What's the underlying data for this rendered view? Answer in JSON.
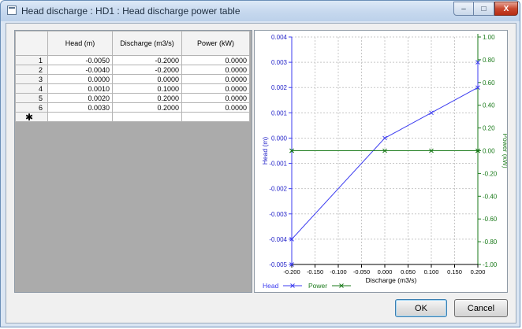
{
  "window": {
    "title": "Head discharge : HD1 : Head discharge power table",
    "min_glyph": "–",
    "max_glyph": "□",
    "close_glyph": "X"
  },
  "table": {
    "columns": [
      "Head (m)",
      "Discharge (m3/s)",
      "Power (kW)"
    ],
    "rows": [
      {
        "index": "1",
        "head": "-0.0050",
        "discharge": "-0.2000",
        "power": "0.0000"
      },
      {
        "index": "2",
        "head": "-0.0040",
        "discharge": "-0.2000",
        "power": "0.0000"
      },
      {
        "index": "3",
        "head": "0.0000",
        "discharge": "0.0000",
        "power": "0.0000"
      },
      {
        "index": "4",
        "head": "0.0010",
        "discharge": "0.1000",
        "power": "0.0000"
      },
      {
        "index": "5",
        "head": "0.0020",
        "discharge": "0.2000",
        "power": "0.0000"
      },
      {
        "index": "6",
        "head": "0.0030",
        "discharge": "0.2000",
        "power": "0.0000"
      }
    ],
    "new_row_marker": "✱"
  },
  "chart_data": {
    "type": "line",
    "xlabel": "Discharge (m3/s)",
    "ylabel_left": "Head (m)",
    "ylabel_right": "Power (kW)",
    "xlim": [
      -0.2,
      0.2
    ],
    "ylim_left": [
      -0.005,
      0.004
    ],
    "ylim_right": [
      -1.0,
      1.0
    ],
    "x_ticks": [
      "-0.200",
      "-0.150",
      "-0.100",
      "-0.050",
      "0.000",
      "0.050",
      "0.100",
      "0.150",
      "0.200"
    ],
    "y_left_ticks": [
      "0.004",
      "0.003",
      "0.002",
      "0.001",
      "0.000",
      "-0.001",
      "-0.002",
      "-0.003",
      "-0.004",
      "-0.005"
    ],
    "y_right_ticks": [
      "1.00",
      "0.80",
      "0.60",
      "0.40",
      "0.20",
      "0.00",
      "-0.20",
      "-0.40",
      "-0.60",
      "-0.80",
      "-1.00"
    ],
    "grid": true,
    "legend_placement": "bottom-left",
    "series": [
      {
        "name": "Head",
        "axis": "left",
        "color": "#3c3cf0",
        "x": [
          -0.2,
          -0.2,
          0.0,
          0.1,
          0.2,
          0.2
        ],
        "y": [
          -0.005,
          -0.004,
          0.0,
          0.001,
          0.002,
          0.003
        ]
      },
      {
        "name": "Power",
        "axis": "right",
        "color": "#1a7a1a",
        "x": [
          -0.2,
          -0.2,
          0.0,
          0.1,
          0.2,
          0.2
        ],
        "y": [
          0.0,
          0.0,
          0.0,
          0.0,
          0.0,
          0.0
        ]
      }
    ]
  },
  "buttons": {
    "ok": "OK",
    "cancel": "Cancel"
  }
}
